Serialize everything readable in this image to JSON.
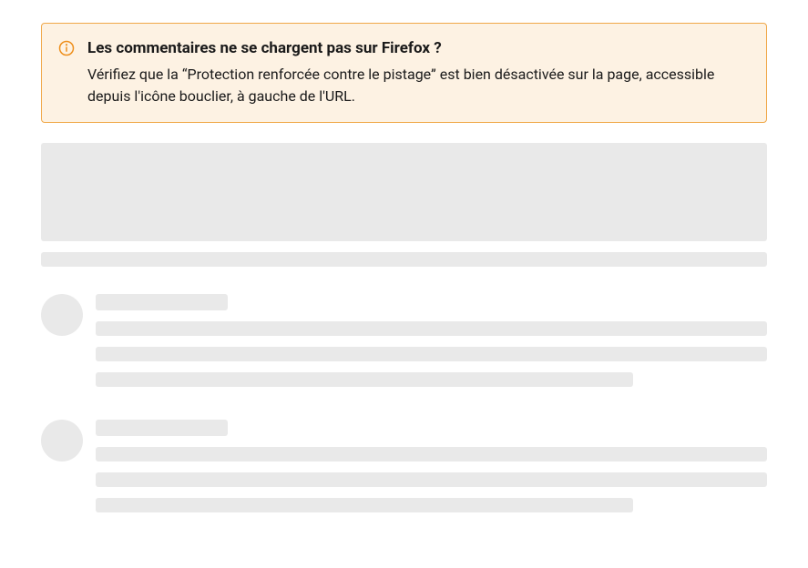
{
  "alert": {
    "title": "Les commentaires ne se chargent pas sur Firefox ?",
    "body": "Vérifiez que la “Protection renforcée contre le pistage” est bien désactivée sur la page, accessible depuis l'icône bouclier, à gauche de l'URL."
  }
}
